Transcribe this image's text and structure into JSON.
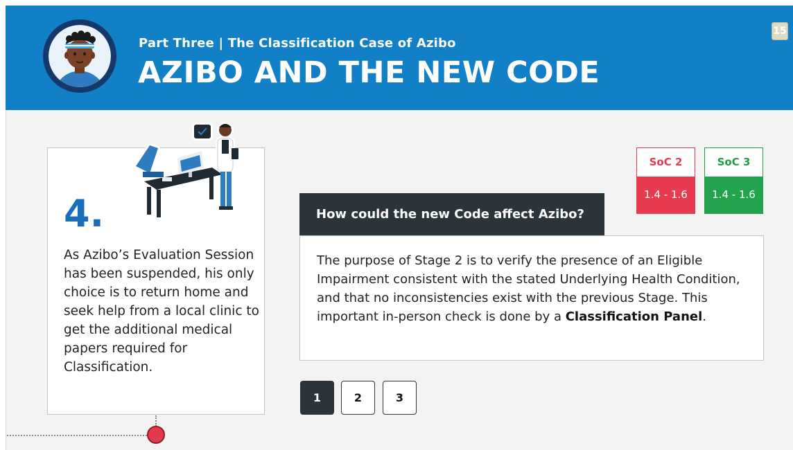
{
  "header": {
    "subtitle": "Part Three | The Classification Case of Azibo",
    "title": "AZIBO AND THE NEW CODE",
    "page_number": "15",
    "background_color": "#1280c6"
  },
  "avatar": {
    "icon": "azibo-avatar-icon"
  },
  "step": {
    "number": "4.",
    "text": "As Azibo’s Evaluation Session has been suspended, his only choice is to return home and seek help from a local clinic to get the additional medical papers required for Classification.",
    "illustration": "doctor-clinic-illustration"
  },
  "soc": [
    {
      "label": "SoC 2",
      "range": "1.4 - 1.6",
      "color": "#e23b4d"
    },
    {
      "label": "SoC 3",
      "range": "1.4 - 1.6",
      "color": "#22a34c"
    }
  ],
  "question": {
    "title": "How could the new Code affect Azibo?",
    "answer_part1": "The purpose of Stage 2 is to verify the presence of an Eligible Impairment consistent with the stated Underlying Health Condition, and that no inconsistencies exist with the previous Stage. This important in-person check is done by a ",
    "answer_bold": "Classification Panel",
    "answer_end": "."
  },
  "pagination": {
    "pages": [
      "1",
      "2",
      "3"
    ],
    "active": "1"
  }
}
